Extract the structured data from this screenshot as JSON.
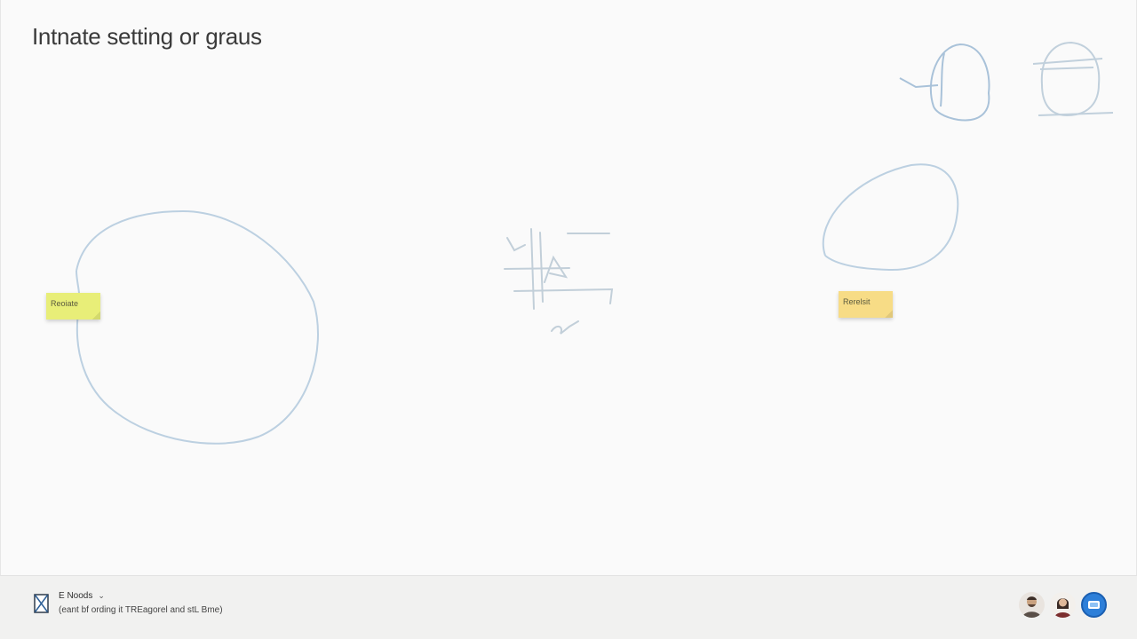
{
  "board": {
    "title": "Intnate setting or graus"
  },
  "stickies": [
    {
      "text": "Reoiate",
      "color": "#e8ee78"
    },
    {
      "text": "Rerelsit",
      "color": "#f7dc86"
    }
  ],
  "footer": {
    "title": "E Noods",
    "subtitle": "(eant bf ording it TREagorel and stL Bme)",
    "icon": "hourglass-icon"
  },
  "collaborators": [
    {
      "name": "avatar-man-beard"
    },
    {
      "name": "avatar-woman"
    },
    {
      "name": "avatar-app-blue"
    }
  ],
  "colors": {
    "stroke": "#b9cfe0",
    "canvas": "#fafafa",
    "footer": "#f1f1f0",
    "sticky_green": "#e8ee78",
    "sticky_yellow": "#f7dc86"
  }
}
